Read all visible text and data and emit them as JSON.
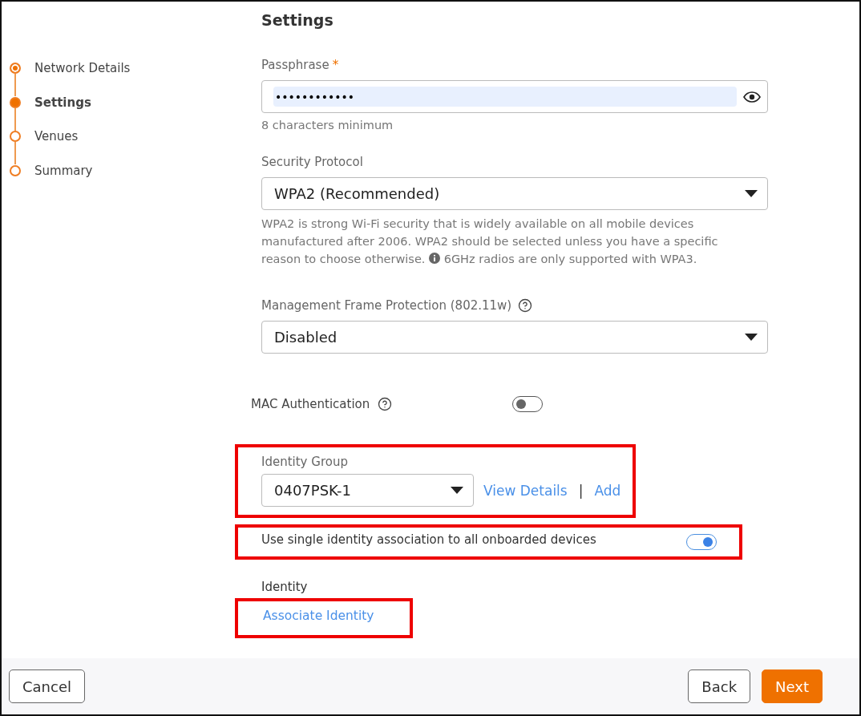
{
  "steps": [
    {
      "label": "Network Details",
      "selected": false,
      "completed": true
    },
    {
      "label": "Settings",
      "selected": true,
      "completed": false
    },
    {
      "label": "Venues",
      "selected": false,
      "completed": false
    },
    {
      "label": "Summary",
      "selected": false,
      "completed": false
    }
  ],
  "title": "Settings",
  "passphrase": {
    "label": "Passphrase",
    "required_mark": "*",
    "value": "••••••••••••",
    "hint": "8 characters minimum"
  },
  "security_protocol": {
    "label": "Security Protocol",
    "value": "WPA2 (Recommended)",
    "description": "WPA2 is strong Wi-Fi security that is widely available on all mobile devices manufactured after 2006. WPA2 should be selected unless you have a specific reason to choose otherwise.",
    "note": "6GHz radios are only supported with WPA3."
  },
  "mfp": {
    "label": "Management Frame Protection (802.11w)",
    "value": "Disabled"
  },
  "mac_auth": {
    "label": "MAC Authentication",
    "on": false
  },
  "identity_group": {
    "label": "Identity Group",
    "value": "0407PSK-1",
    "links": [
      "View Details",
      "Add"
    ],
    "separator": "|"
  },
  "single_identity": {
    "label": "Use single identity association to all onboarded devices",
    "on": true
  },
  "identity": {
    "label": "Identity",
    "link": "Associate Identity"
  },
  "footer": {
    "cancel": "Cancel",
    "back": "Back",
    "next": "Next"
  }
}
